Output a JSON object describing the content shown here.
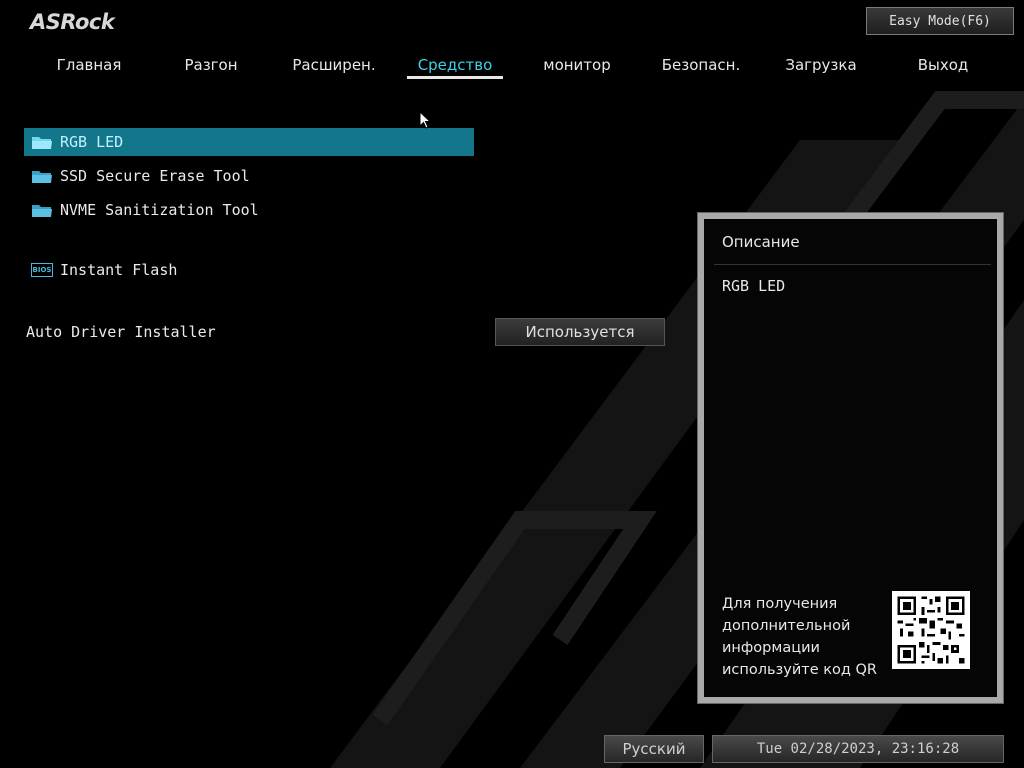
{
  "brand": {
    "logo_text": "ASRock"
  },
  "header": {
    "easy_mode_label": "Easy Mode(F6)"
  },
  "nav": {
    "active_index": 3,
    "tabs": [
      {
        "label": "Главная"
      },
      {
        "label": "Разгон"
      },
      {
        "label": "Расширен."
      },
      {
        "label": "Средство"
      },
      {
        "label": "монитор"
      },
      {
        "label": "Безопасн."
      },
      {
        "label": "Загрузка"
      },
      {
        "label": "Выход"
      }
    ]
  },
  "menu": {
    "items": [
      {
        "label": "RGB LED",
        "icon": "folder-icon",
        "selected": true
      },
      {
        "label": "SSD Secure Erase Tool",
        "icon": "folder-icon",
        "selected": false
      },
      {
        "label": "NVME Sanitization Tool",
        "icon": "folder-icon",
        "selected": false
      },
      {
        "label": "Instant Flash",
        "icon": "bios-icon",
        "icon_text": "BIOS",
        "selected": false
      }
    ]
  },
  "settings": {
    "auto_driver": {
      "label": "Auto Driver Installer",
      "value": "Используется"
    }
  },
  "description": {
    "title": "Описание",
    "text": "RGB LED",
    "qr_lines": [
      "Для получения",
      "дополнительной",
      "информации",
      "используйте код QR"
    ]
  },
  "footer": {
    "language": "Русский",
    "datetime": "Tue 02/28/2023, 23:16:28"
  },
  "colors": {
    "accent": "#3fd0e8",
    "selection": "#13768a",
    "panel_border": "#a9a9a9"
  }
}
